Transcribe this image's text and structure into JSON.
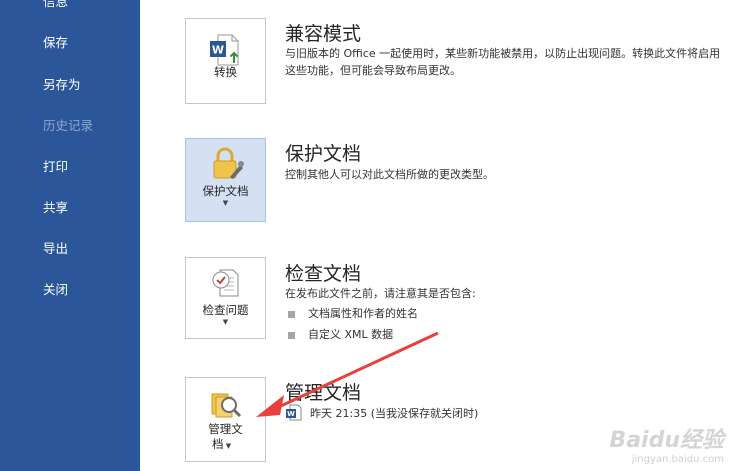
{
  "sidebar": {
    "items": [
      {
        "label": "信息",
        "disabled": false
      },
      {
        "label": "保存",
        "disabled": false
      },
      {
        "label": "另存为",
        "disabled": false
      },
      {
        "label": "历史记录",
        "disabled": true
      },
      {
        "label": "打印",
        "disabled": false
      },
      {
        "label": "共享",
        "disabled": false
      },
      {
        "label": "导出",
        "disabled": false
      },
      {
        "label": "关闭",
        "disabled": false
      }
    ]
  },
  "sections": {
    "compat": {
      "tile_label": "转换",
      "title": "兼容模式",
      "desc": "与旧版本的 Office 一起使用时，某些新功能被禁用，以防止出现问题。转换此文件将启用这些功能，但可能会导致布局更改。"
    },
    "protect": {
      "tile_label": "保护文档",
      "title": "保护文档",
      "desc": "控制其他人可以对此文档所做的更改类型。"
    },
    "inspect": {
      "tile_label": "检查问题",
      "title": "检查文档",
      "desc": "在发布此文件之前，请注意其是否包含:",
      "bullets": [
        "文档属性和作者的姓名",
        "自定义 XML 数据"
      ]
    },
    "manage": {
      "tile_label_line1": "管理文",
      "tile_label_line2": "档",
      "title": "管理文档",
      "version_text": "昨天 21:35 (当我没保存就关闭时)"
    }
  },
  "watermark": {
    "brand": "Baidu经验",
    "url": "jingyan.baidu.com"
  },
  "colors": {
    "sidebar": "#2b579a",
    "active_tile": "#d5e1f2",
    "arrow": "#e8403a"
  }
}
